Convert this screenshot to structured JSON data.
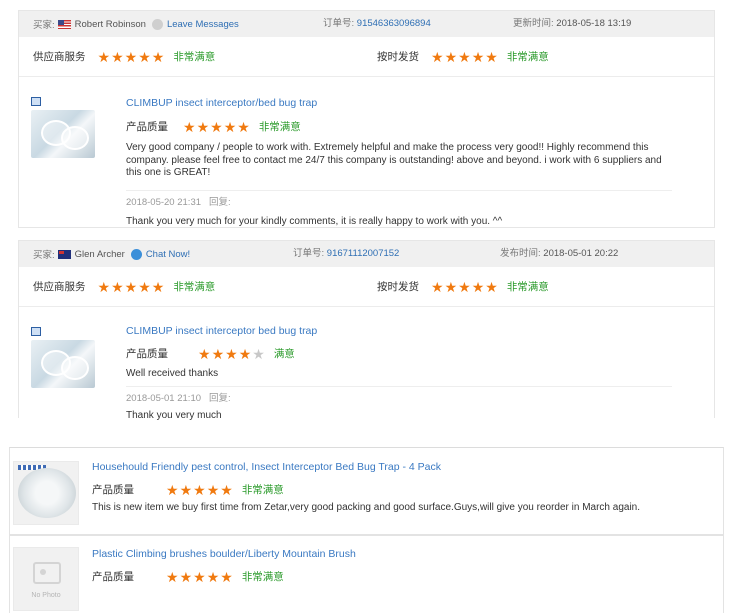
{
  "reviews": [
    {
      "buyer_label": "买家:",
      "buyer_name": "Robert Robinson",
      "buyer_flag": "US",
      "contact_link": "Leave Messages",
      "order_label": "订单号:",
      "order_number": "91546363096894",
      "date_label": "更新时间:",
      "date": "2018-05-18 13:19",
      "supplier_service_label": "供应商服务",
      "supplier_service_stars": 5,
      "supplier_service_verdict": "非常满意",
      "shipping_label": "按时发货",
      "shipping_stars": 5,
      "shipping_verdict": "非常满意",
      "product_title": "CLIMBUP insect interceptor/bed bug trap",
      "quality_label": "产品质量",
      "quality_stars": 5,
      "quality_verdict": "非常满意",
      "comment": "Very good company / people to work with. Extremely helpful and make the process very good!! Highly recommend this company. please feel free to contact me 24/7 this company is outstanding! above and beyond. i work with 6 suppliers and this one is GREAT!",
      "reply_date": "2018-05-20 21:31",
      "reply_label": "回复:",
      "reply_text": "Thank you very much for your kindly comments, it is really happy to work with you. ^^"
    },
    {
      "buyer_label": "买家:",
      "buyer_name": "Glen Archer",
      "buyer_flag": "AU",
      "contact_link": "Chat Now!",
      "order_label": "订单号:",
      "order_number": "91671112007152",
      "date_label": "发布时间:",
      "date": "2018-05-01 20:22",
      "supplier_service_label": "供应商服务",
      "supplier_service_stars": 5,
      "supplier_service_verdict": "非常满意",
      "shipping_label": "按时发货",
      "shipping_stars": 5,
      "shipping_verdict": "非常满意",
      "product_title": "CLIMBUP insect interceptor bed bug trap",
      "quality_label": "产品质量",
      "quality_stars": 4,
      "quality_verdict": "满意",
      "comment": "Well received thanks",
      "reply_date": "2018-05-01 21:10",
      "reply_label": "回复:",
      "reply_text": "Thank you very much"
    }
  ],
  "lower_reviews": [
    {
      "product_title": "Househould Friendly pest control, Insect Interceptor Bed Bug Trap - 4 Pack",
      "quality_label": "产品质量",
      "quality_stars": 5,
      "quality_verdict": "非常满意",
      "comment": "This is new item we buy first time from Zetar,very good packing and good surface.Guys,will give you reorder in March again."
    },
    {
      "product_title": "Plastic Climbing brushes boulder/Liberty Mountain Brush",
      "quality_label": "产品质量",
      "quality_stars": 5,
      "quality_verdict": "非常满意",
      "no_photo_label": "No Photo"
    }
  ],
  "colors": {
    "star": "#f07a10",
    "verdict": "#2a9a2a",
    "link": "#2f6fb4",
    "header_bg": "#f0f0f0"
  }
}
